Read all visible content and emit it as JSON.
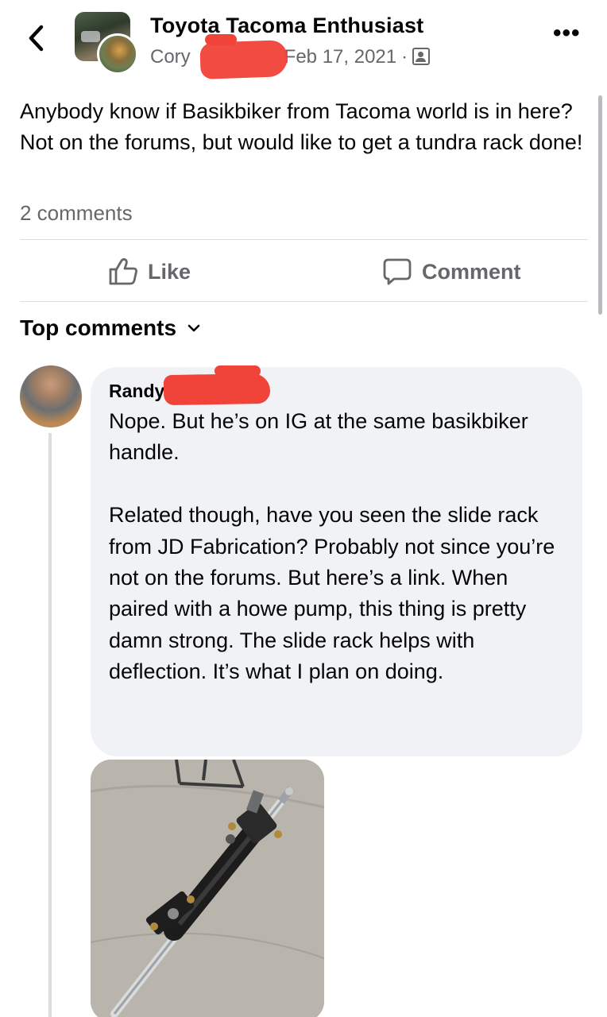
{
  "header": {
    "back_icon": "chevron-left-icon",
    "group_name": "Toyota Tacoma Enthusiast",
    "author_name": "Cory",
    "date": "Feb 17, 2021",
    "separator": "·",
    "privacy_icon": "public-group-icon",
    "more_icon": "more-horizontal-icon",
    "more_label": "•••"
  },
  "post": {
    "text": "Anybody know if Basikbiker from Tacoma world is in here? Not on the forums, but would like to get a tundra rack done!",
    "comment_count": "2 comments"
  },
  "actions": {
    "like_label": "Like",
    "like_icon": "thumbs-up-icon",
    "comment_label": "Comment",
    "comment_icon": "speech-bubble-icon"
  },
  "comments_section": {
    "sort_label": "Top comments",
    "sort_icon": "chevron-down-icon"
  },
  "comments": [
    {
      "author": "Randy",
      "text": "Nope. But he’s on IG at the same basikbiker handle.\n\nRelated though, have you seen the slide rack from JD Fabrication? Probably not since you’re not on the forums. But here’s a link. When paired with a howe pump, this thing is pretty damn strong. The slide rack helps with deflection. It’s what I plan on doing.",
      "attachment": "steering-rack-photo"
    }
  ],
  "colors": {
    "text_primary": "#050505",
    "text_secondary": "#65676b",
    "bubble_bg": "#f0f2f5",
    "divider": "#dadde1",
    "redaction": "#f0443a"
  }
}
